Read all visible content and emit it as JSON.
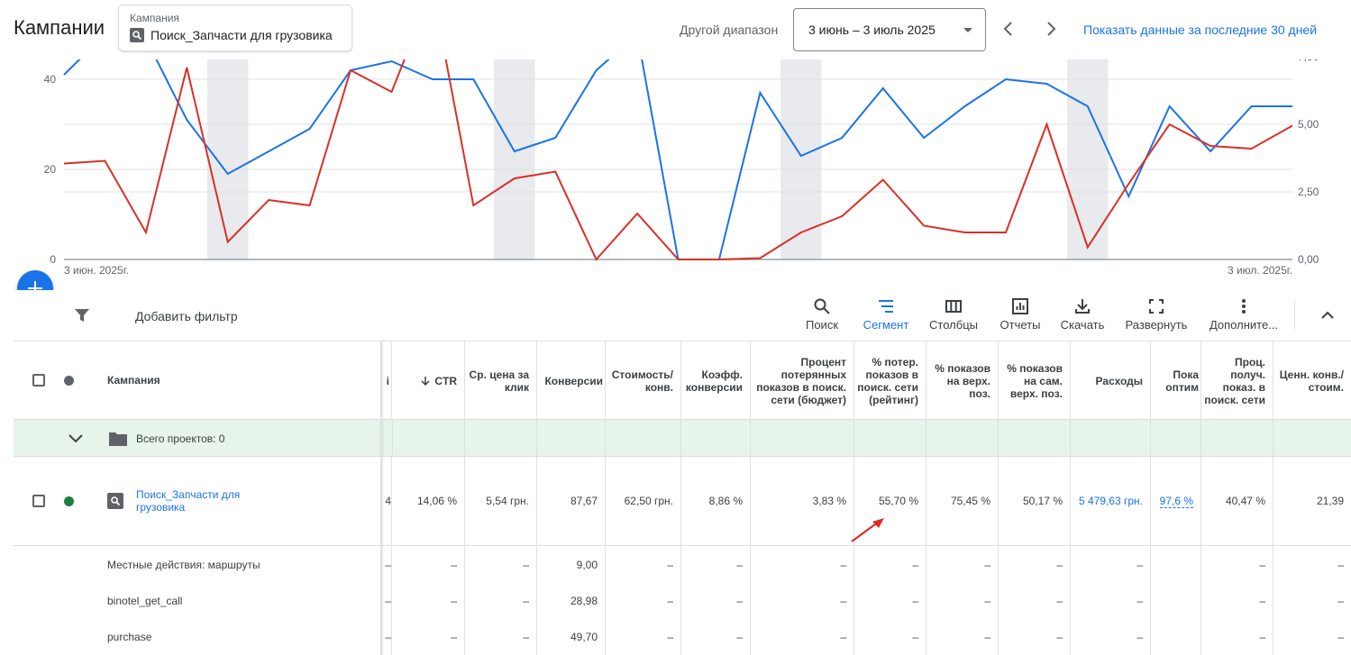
{
  "header": {
    "title": "Кампании",
    "campaign_label": "Кампания",
    "campaign_name": "Поиск_Запчасти для грузовика",
    "range_label": "Другой диапазон",
    "date_range": "3 июнь – 3 июль 2025",
    "last30_link": "Показать данные за последние 30 дней"
  },
  "chart_data": {
    "type": "line",
    "x_start_label": "3 июн. 2025г.",
    "x_end_label": "3 июл. 2025г.",
    "left_axis_ticks": [
      "0",
      "20",
      "40"
    ],
    "right_axis_ticks": [
      "0,00",
      "2,50",
      "5,00",
      "7,50"
    ],
    "left_axis_range": [
      0,
      45
    ],
    "right_axis_range": [
      0,
      7.5
    ],
    "weekend_bands": true,
    "colors": {
      "blue": "#1a73e8",
      "red": "#d93025"
    },
    "series": [
      {
        "axis": "left",
        "color": "#1a73e8",
        "values": [
          41,
          50,
          49,
          31,
          19,
          24,
          29,
          42,
          44,
          40,
          40,
          24,
          27,
          42,
          50,
          0,
          0,
          37,
          23,
          27,
          38,
          27,
          34,
          40,
          39,
          34,
          14,
          34,
          24,
          34,
          34
        ]
      },
      {
        "axis": "right",
        "color": "#d93025",
        "values": [
          3.55,
          3.65,
          1.0,
          7.1,
          0.65,
          2.2,
          2.0,
          7.0,
          6.2,
          10,
          2.0,
          3.0,
          3.25,
          0.0,
          1.7,
          0.0,
          0.0,
          0.05,
          1.0,
          1.6,
          2.95,
          1.25,
          1.0,
          1.0,
          5.0,
          0.45,
          2.8,
          5.0,
          4.2,
          4.1,
          4.95
        ]
      }
    ]
  },
  "toolbar": {
    "filter_label": "Добавить фильтр",
    "search": "Поиск",
    "segment": "Сегмент",
    "columns": "Столбцы",
    "reports": "Отчеты",
    "download": "Скачать",
    "expand": "Развернуть",
    "more": "Дополните..."
  },
  "table": {
    "headers": {
      "campaign": "Кампания",
      "prev_partial": "і",
      "ctr": "CTR",
      "avg_cpc": "Ср. цена за клик",
      "conversions": "Конверсии",
      "cost_conv": "Стоимость/ конв.",
      "conv_rate": "Коэфф. конверсии",
      "lost_budget": "Процент потерянных показов в поиск. сети (бюджет)",
      "lost_rank": "% потер. показов в поиск. сети (рейтинг)",
      "top_pos": "% показов на верх. поз.",
      "abs_top_pos": "% показов на сам. верх. поз.",
      "cost": "Расходы",
      "opt_score": "Пока оптим",
      "impr_share": "Проц. получ. показ. в поиск. сети",
      "value_cost": "Ценн. конв./ стоим."
    },
    "total_row": {
      "label": "Всего проектов: 0"
    },
    "campaign_row": {
      "name": "Поиск_Запчасти для грузовика",
      "prev_partial": "4",
      "ctr": "14,06 %",
      "avg_cpc": "5,54 грн.",
      "conversions": "87,67",
      "cost_conv": "62,50 грн.",
      "conv_rate": "8,86 %",
      "lost_budget": "3,83 %",
      "lost_rank": "55,70 %",
      "top_pos": "75,45 %",
      "abs_top_pos": "50,17 %",
      "cost": "5 479,63 грн.",
      "opt_score": "97,6 %",
      "impr_share": "40,47 %",
      "value_cost": "21,39"
    },
    "sub_rows": [
      {
        "name": "Местные действия: маршруты",
        "conversions": "9,00"
      },
      {
        "name": "binotel_get_call",
        "conversions": "28,98"
      },
      {
        "name": "purchase",
        "conversions": "49,70"
      }
    ],
    "dash": "–"
  }
}
